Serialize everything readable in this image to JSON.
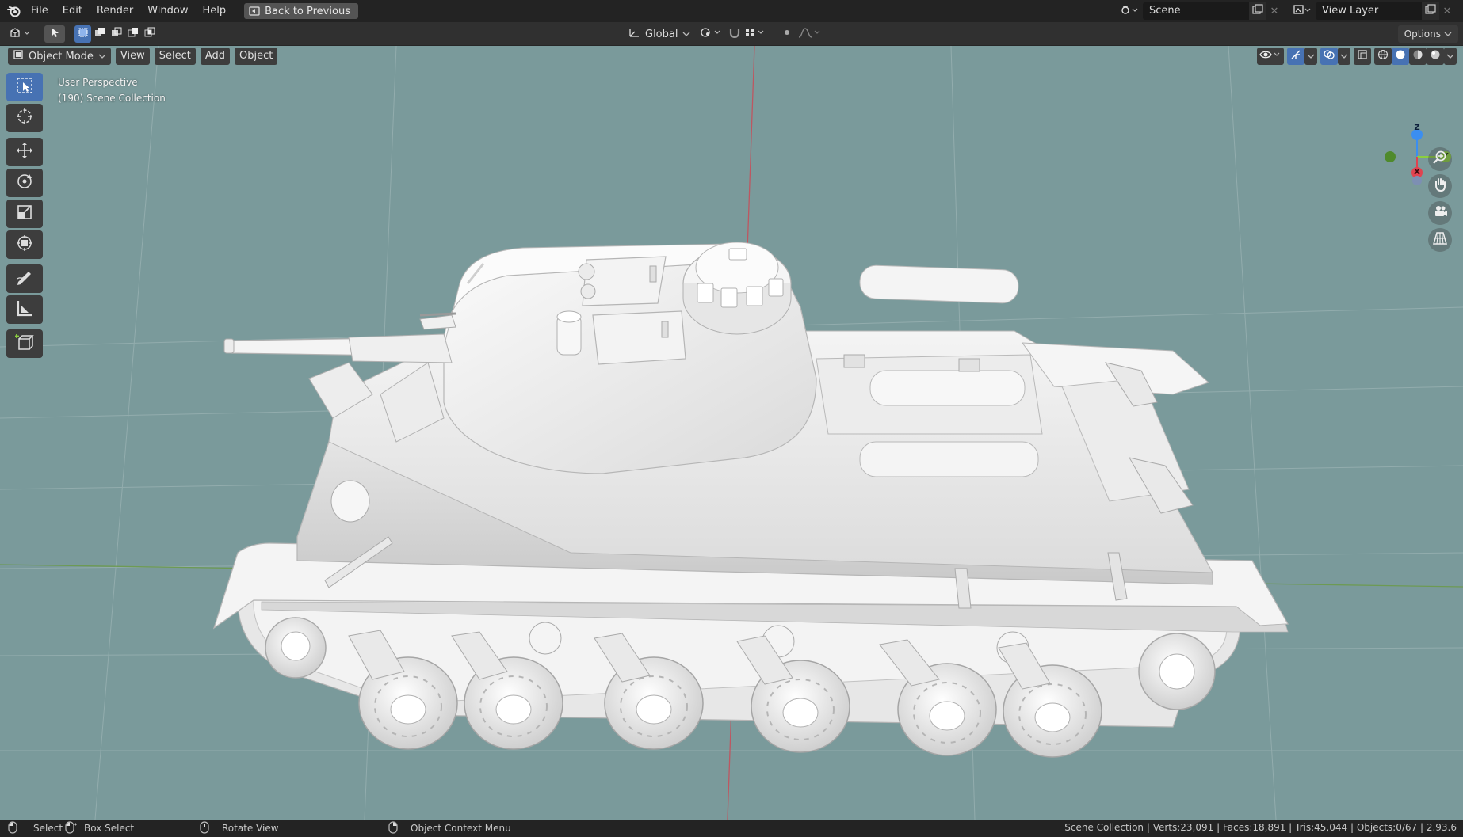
{
  "menubar": {
    "items": [
      "File",
      "Edit",
      "Render",
      "Window",
      "Help"
    ],
    "back_button": "Back to Previous",
    "scene": "Scene",
    "view_layer": "View Layer"
  },
  "tool_header": {
    "orientation": "Global",
    "options": "Options"
  },
  "viewport_header": {
    "mode": "Object Mode",
    "menus": [
      "View",
      "Select",
      "Add",
      "Object"
    ]
  },
  "viewport": {
    "perspective": "User Perspective",
    "collection": "(190) Scene Collection",
    "background_color": "#7a9a9b",
    "gizmo": {
      "z": "Z",
      "y": "Y",
      "x": "X"
    }
  },
  "statusbar": {
    "select": "Select",
    "box_select": "Box Select",
    "rotate_view": "Rotate View",
    "context_menu": "Object Context Menu",
    "stats": "Scene Collection | Verts:23,091 | Faces:18,891 | Tris:45,044 | Objects:0/67 | 2.93.6"
  },
  "colors": {
    "accent": "#4772b3",
    "x_axis": "#e04350",
    "y_axis": "#8bcf3f",
    "z_axis": "#3b8ef0"
  }
}
